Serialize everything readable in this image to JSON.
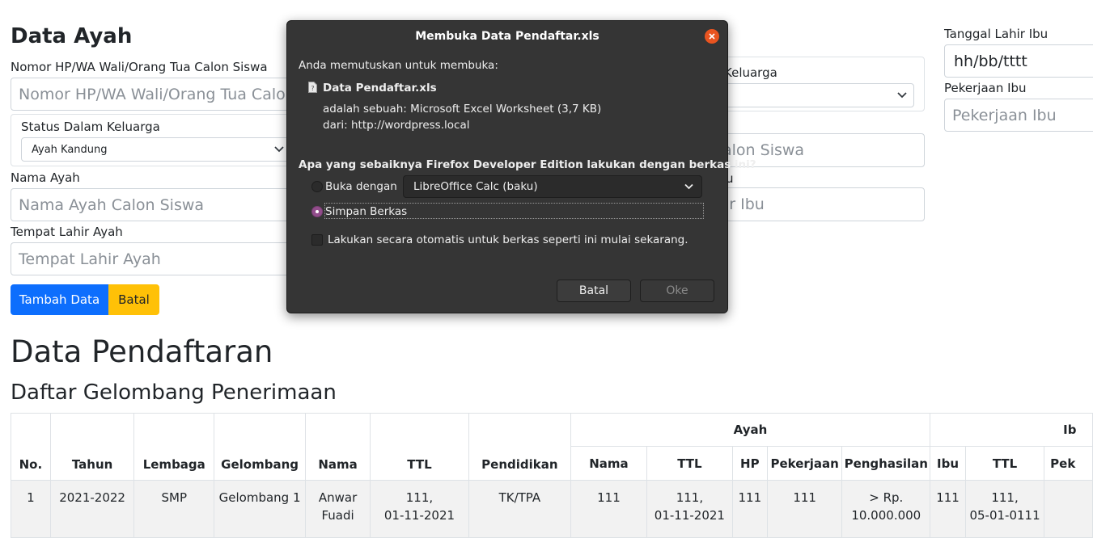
{
  "father": {
    "heading": "Data Ayah",
    "phone_label": "Nomor HP/WA Wali/Orang Tua Calon Siswa",
    "phone_placeholder": "Nomor HP/WA Wali/Orang Tua Calon Siswa",
    "status_label": "Status Dalam Keluarga",
    "status_value": "Ayah Kandung",
    "name_label": "Nama Ayah",
    "name_placeholder": "Nama Ayah Calon Siswa",
    "birthplace_label": "Tempat Lahir Ayah",
    "birthplace_placeholder": "Tempat Lahir Ayah"
  },
  "mother_partial": {
    "status_label_tail": "Keluarga",
    "phone_placeholder_tail": "alon Siswa",
    "label_tail": "u",
    "birthplace_placeholder_tail": "ir Ibu"
  },
  "mother_right": {
    "dob_label": "Tanggal Lahir Ibu",
    "dob_value": "hh/bb/tttt",
    "job_label": "Pekerjaan Ibu",
    "job_placeholder": "Pekerjaan Ibu"
  },
  "buttons": {
    "add": "Tambah Data",
    "cancel": "Batal"
  },
  "page": {
    "title": "Data Pendaftaran",
    "subtitle": "Daftar Gelombang Penerimaan"
  },
  "table": {
    "group_father": "Ayah",
    "group_mother": "Ib",
    "headers": [
      "No.",
      "Tahun",
      "Lembaga",
      "Gelombang",
      "Nama",
      "TTL",
      "Pendidikan",
      "Nama",
      "TTL",
      "HP",
      "Pekerjaan",
      "Penghasilan",
      "Ibu",
      "TTL",
      "Pek"
    ],
    "row": [
      "1",
      "2021-2022",
      "SMP",
      "Gelombang 1",
      "Anwar\nFuadi",
      "111,\n01-11-2021",
      "TK/TPA",
      "111",
      "111,\n01-11-2021",
      "111",
      "111",
      "> Rp.\n10.000.000",
      "111",
      "111,\n05-01-0111",
      ""
    ]
  },
  "dialog": {
    "title": "Membuka Data Pendaftar.xls",
    "intro": "Anda memutuskan untuk membuka:",
    "filename": "Data Pendaftar.xls",
    "type_line": "adalah sebuah: Microsoft Excel Worksheet (3,7 KB)",
    "from_line": "dari: http://wordpress.local",
    "question": "Apa yang sebaiknya Firefox Developer Edition lakukan dengan berkas ini?",
    "open_with_label": "Buka dengan",
    "open_with_app": "LibreOffice Calc (baku)",
    "save_label": "Simpan Berkas",
    "auto_label": "Lakukan secara otomatis untuk berkas seperti ini mulai sekarang.",
    "cancel": "Batal",
    "ok": "Oke",
    "accent_color": "#924d8b",
    "close_color": "#e95420"
  }
}
